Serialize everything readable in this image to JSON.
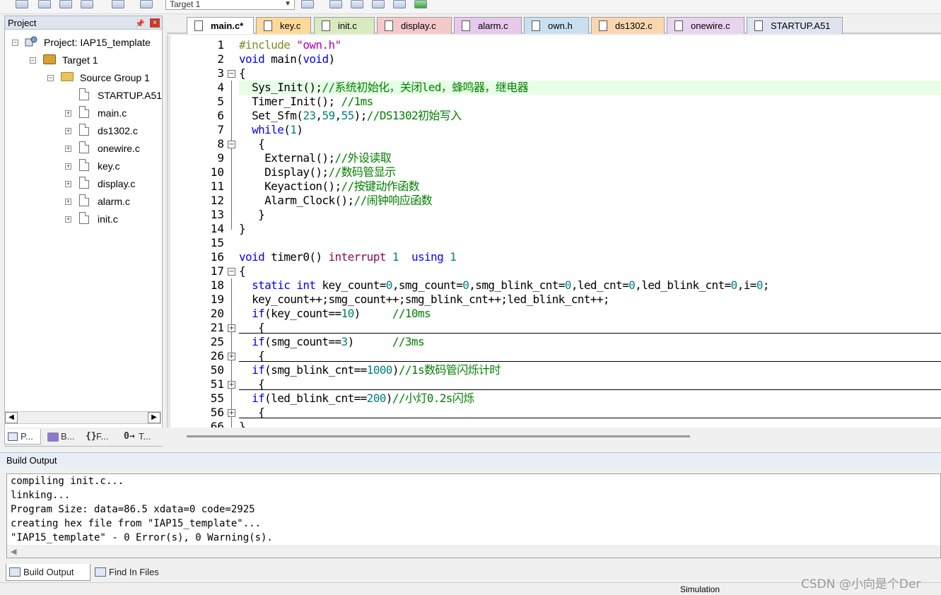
{
  "toolbar": {
    "target_value": "Target 1",
    "icons": [
      "translate-icon",
      "build-icon",
      "rebuild-icon",
      "batch-build-icon",
      "download-icon",
      "options-icon",
      "manage-components-icon",
      "find-icon",
      "select-packs-icon",
      "component-icon",
      "pack-installer-icon"
    ]
  },
  "project_panel": {
    "title": "Project",
    "pin_label": "ᵖ",
    "close_label": "×",
    "tree": {
      "project": "Project: IAP15_template",
      "target": "Target 1",
      "group": "Source Group 1",
      "files": [
        "STARTUP.A51",
        "main.c",
        "ds1302.c",
        "onewire.c",
        "key.c",
        "display.c",
        "alarm.c",
        "init.c"
      ]
    },
    "tabs": [
      "P...",
      "B...",
      "F...",
      "T..."
    ]
  },
  "editor": {
    "tabs": [
      {
        "label": "main.c*",
        "color": "#ffffff"
      },
      {
        "label": "key.c",
        "color": "#ffd99a"
      },
      {
        "label": "init.c",
        "color": "#d8eac0"
      },
      {
        "label": "display.c",
        "color": "#f5c9c9"
      },
      {
        "label": "alarm.c",
        "color": "#e6c9ec"
      },
      {
        "label": "own.h",
        "color": "#c9e0f2"
      },
      {
        "label": "ds1302.c",
        "color": "#fbd7b0"
      },
      {
        "label": "onewire.c",
        "color": "#e9d4ef"
      },
      {
        "label": "STARTUP.A51",
        "color": "#dde3f0"
      }
    ],
    "line_numbers": [
      "1",
      "2",
      "3",
      "4",
      "5",
      "6",
      "7",
      "8",
      "9",
      "10",
      "11",
      "12",
      "13",
      "14",
      "15",
      "16",
      "17",
      "18",
      "19",
      "20",
      "21",
      "25",
      "26",
      "50",
      "51",
      "55",
      "56",
      "66"
    ],
    "code": {
      "l1_a": "#include ",
      "l1_b": "\"own.h\"",
      "l2_a": "void",
      "l2_b": " main(",
      "l2_c": "void",
      "l2_d": ")",
      "l3": "{",
      "l4_a": "  Sys_Init();",
      "l4_b": "//系统初始化，关闭led，蜂鸣器，继电器",
      "l5_a": "  Timer_Init(); ",
      "l5_b": "//1ms",
      "l6_a": "  Set_Sfm(",
      "l6_b": "23",
      "l6_c": ",",
      "l6_d": "59",
      "l6_e": ",",
      "l6_f": "55",
      "l6_g": ");",
      "l6_h": "//DS1302初始写入",
      "l7_a": "  while",
      "l7_b": "(",
      "l7_c": "1",
      "l7_d": ")",
      "l8": "   {",
      "l9_a": "    External();",
      "l9_b": "//外设读取",
      "l10_a": "    Display();",
      "l10_b": "//数码管显示",
      "l11_a": "    Keyaction();",
      "l11_b": "//按键动作函数",
      "l12_a": "    Alarm_Clock();",
      "l12_b": "//闹钟响应函数",
      "l13": "   }",
      "l14": "}",
      "l16_a": "void",
      "l16_b": " timer0() ",
      "l16_c": "interrupt",
      "l16_d": " ",
      "l16_e": "1",
      "l16_f": "  ",
      "l16_g": "using",
      "l16_h": " ",
      "l16_i": "1",
      "l17": "{",
      "l18_a": "  static",
      "l18_b": " ",
      "l18_c": "int",
      "l18_d": " key_count=",
      "l18_e": "0",
      "l18_f": ",smg_count=",
      "l18_g": "0",
      "l18_h": ",smg_blink_cnt=",
      "l18_i": "0",
      "l18_j": ",led_cnt=",
      "l18_k": "0",
      "l18_l": ",led_blink_cnt=",
      "l18_m": "0",
      "l18_n": ",i=",
      "l18_o": "0",
      "l18_p": ";",
      "l19": "  key_count++;smg_count++;smg_blink_cnt++;led_blink_cnt++;",
      "l20_a": "  if",
      "l20_b": "(key_count==",
      "l20_c": "10",
      "l20_d": ")     ",
      "l20_e": "//10ms",
      "l21": "   {",
      "l25_a": "  if",
      "l25_b": "(smg_count==",
      "l25_c": "3",
      "l25_d": ")      ",
      "l25_e": "//3ms",
      "l26": "   {",
      "l50_a": "  if",
      "l50_b": "(smg_blink_cnt==",
      "l50_c": "1000",
      "l50_d": ")",
      "l50_e": "//1s数码管闪烁计时",
      "l51": "   {",
      "l55_a": "  if",
      "l55_b": "(led_blink_cnt==",
      "l55_c": "200",
      "l55_d": ")",
      "l55_e": "//小灯0.2s闪烁",
      "l56": "   {",
      "l66": "}"
    }
  },
  "build_output": {
    "title": "Build Output",
    "lines": [
      "compiling init.c...",
      "linking...",
      "Program Size: data=86.5 xdata=0 code=2925",
      "creating hex file from \"IAP15_template\"...",
      "\"IAP15_template\" - 0 Error(s), 0 Warning(s)."
    ],
    "tabs": [
      "Build Output",
      "Find In Files"
    ]
  },
  "status_bar": {
    "mode": "Simulation"
  },
  "watermark": "CSDN @小向是个Der",
  "colors": {
    "keyword": "#0000ff",
    "comment": "#008000",
    "number": "#008080",
    "string": "#b000b0",
    "preprocessor": "#7e8c2a",
    "current_line": "#e6ffe6"
  }
}
